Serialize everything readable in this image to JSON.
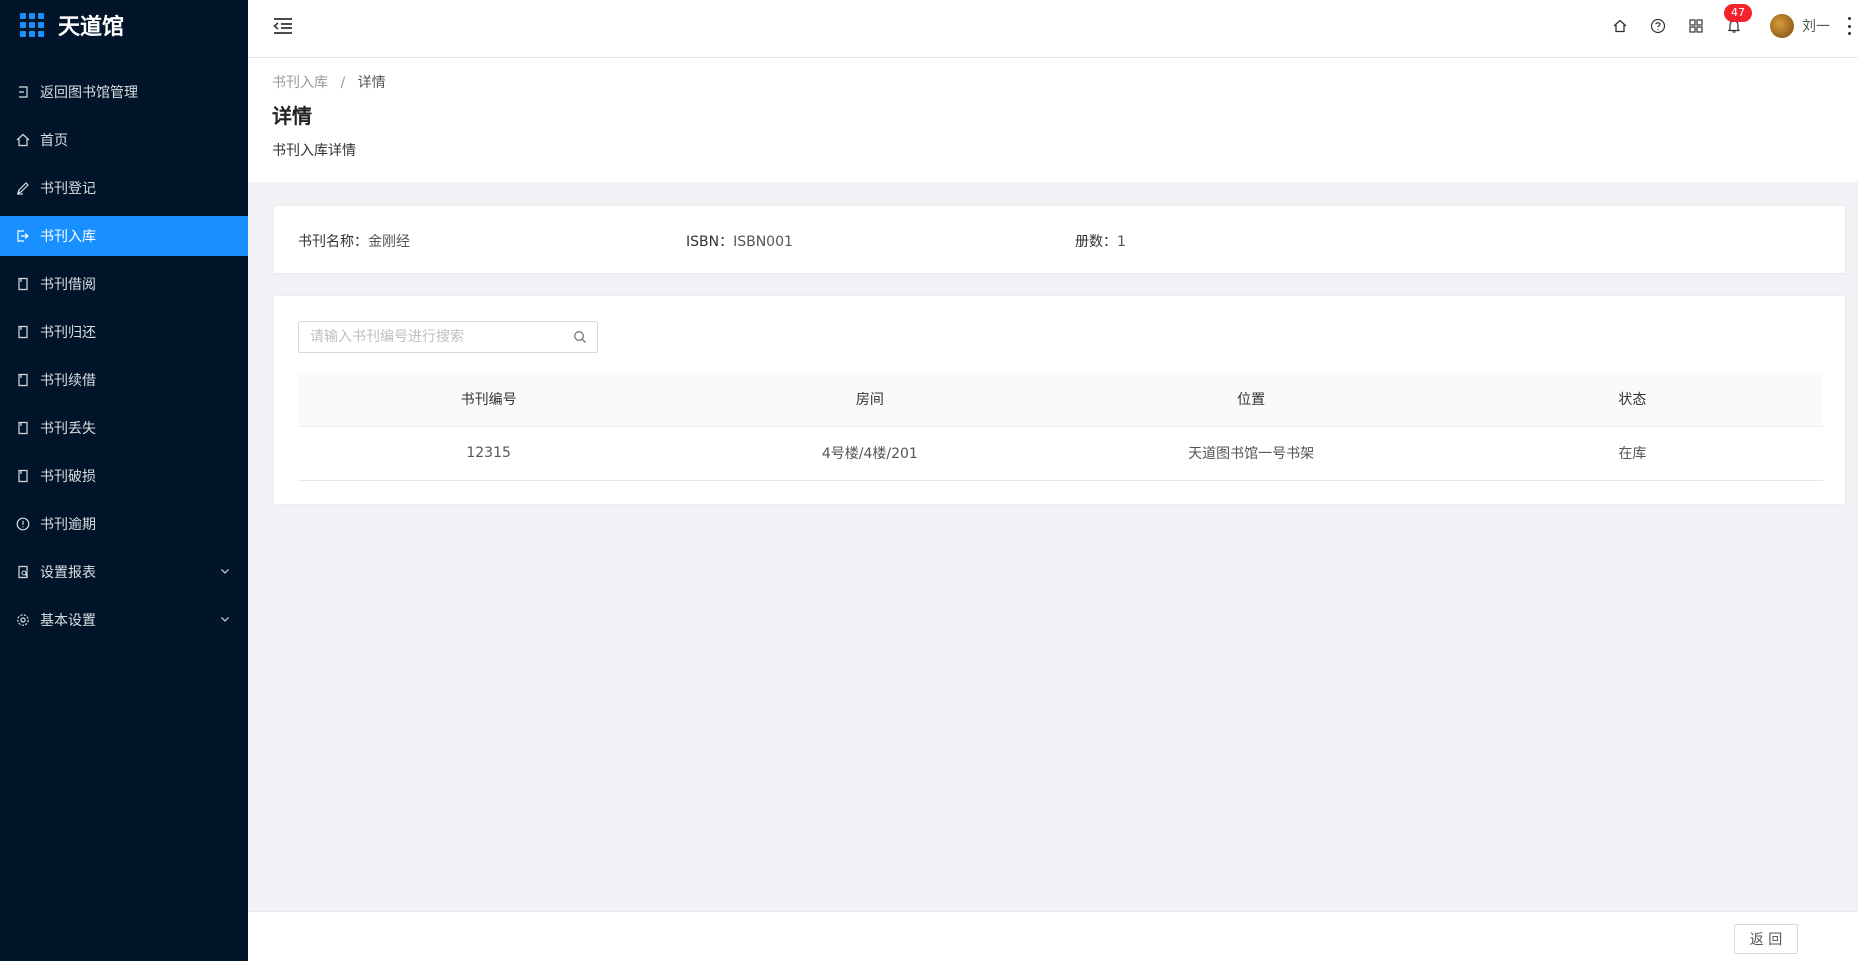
{
  "app": {
    "title": "天道馆"
  },
  "sidebar": {
    "items": [
      {
        "label": "返回图书馆管理",
        "icon": "return-icon",
        "active": false
      },
      {
        "label": "首页",
        "icon": "home-icon",
        "active": false
      },
      {
        "label": "书刊登记",
        "icon": "pen-icon",
        "active": false
      },
      {
        "label": "书刊入库",
        "icon": "import-icon",
        "active": true
      },
      {
        "label": "书刊借阅",
        "icon": "book-icon",
        "active": false
      },
      {
        "label": "书刊归还",
        "icon": "book-icon",
        "active": false
      },
      {
        "label": "书刊续借",
        "icon": "book-icon",
        "active": false
      },
      {
        "label": "书刊丢失",
        "icon": "book-icon",
        "active": false
      },
      {
        "label": "书刊破损",
        "icon": "book-icon",
        "active": false
      },
      {
        "label": "书刊逾期",
        "icon": "exclamation-circle-icon",
        "active": false
      },
      {
        "label": "设置报表",
        "icon": "report-icon",
        "active": false,
        "expandable": true
      },
      {
        "label": "基本设置",
        "icon": "gear-icon",
        "active": false,
        "expandable": true
      }
    ]
  },
  "header": {
    "notification_count": "47",
    "user_name": "刘一",
    "icons": [
      "menu-fold-icon",
      "home-icon",
      "question-icon",
      "appstore-icon",
      "bell-icon",
      "more-icon"
    ]
  },
  "page": {
    "breadcrumb": [
      "书刊入库",
      "详情"
    ],
    "breadcrumb_sep": "/",
    "title": "详情",
    "description": "书刊入库详情"
  },
  "info": {
    "name_label": "书刊名称：",
    "name_value": "金刚经",
    "isbn_label": "ISBN：",
    "isbn_value": "ISBN001",
    "count_label": "册数：",
    "count_value": "1"
  },
  "search": {
    "placeholder": "请输入书刊编号进行搜索"
  },
  "table": {
    "columns": [
      "书刊编号",
      "房间",
      "位置",
      "状态"
    ],
    "rows": [
      [
        "12315",
        "4号楼/4楼/201",
        "天道图书馆一号书架",
        "在库"
      ]
    ]
  },
  "footer": {
    "back_label": "返 回"
  },
  "colors": {
    "sidebar_bg": "#001529",
    "accent": "#1890ff",
    "badge": "#f5222d"
  }
}
